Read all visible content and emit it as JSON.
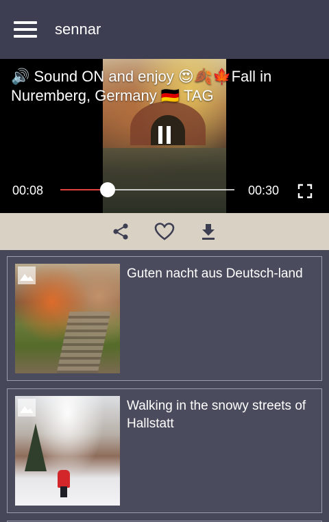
{
  "app": {
    "title": "sennar"
  },
  "player": {
    "title": "🔊 Sound ON and enjoy 😍🍂🍁Fall in Nuremberg, Germany 🇩🇪 TAG",
    "current_time": "00:08",
    "total_time": "00:30",
    "progress": 0.27,
    "state": "playing",
    "icons": [
      "pause-icon",
      "fullscreen-icon"
    ]
  },
  "actions": {
    "icons": [
      "share-icon",
      "heart-icon",
      "download-icon"
    ]
  },
  "feed": {
    "items": [
      {
        "title": "Guten nacht aus Deutsch-land"
      },
      {
        "title": "Walking in the snowy streets of Hallstatt"
      }
    ]
  },
  "colors": {
    "app_bar": "#3d3e52",
    "background": "#464759",
    "action_bar": "#d8d1c4",
    "seek_played": "#e3413f",
    "icon": "#3d3e52"
  }
}
